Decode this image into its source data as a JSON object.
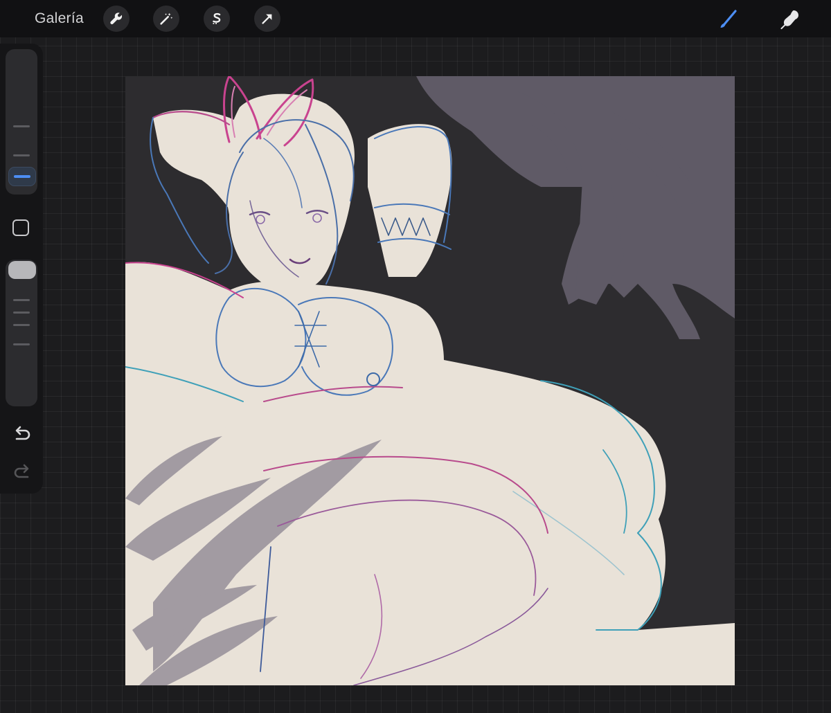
{
  "app": {
    "gallery_label": "Galería"
  },
  "toolbar": {
    "left_tools": [
      {
        "name": "wrench-icon"
      },
      {
        "name": "magic-wand-icon"
      },
      {
        "name": "selection-s-icon"
      },
      {
        "name": "transform-arrow-icon"
      }
    ],
    "right_tools": [
      {
        "name": "brush-icon",
        "active": true
      },
      {
        "name": "smudge-icon",
        "active": false
      }
    ]
  },
  "sidebar": {
    "brush_size_level": 0.22,
    "opacity_level": 0.95,
    "controls": [
      "modify-square-icon",
      "undo-icon",
      "redo-icon"
    ]
  },
  "colors": {
    "accent": "#4d8ef3",
    "canvas_background": "#2d2c2f",
    "skin_fill": "#e9e2d8",
    "shadow_purple": "#5f5a66",
    "line_magenta": "#b84a8c",
    "line_blue": "#4a78b8",
    "line_cyan": "#3fa0b8"
  }
}
